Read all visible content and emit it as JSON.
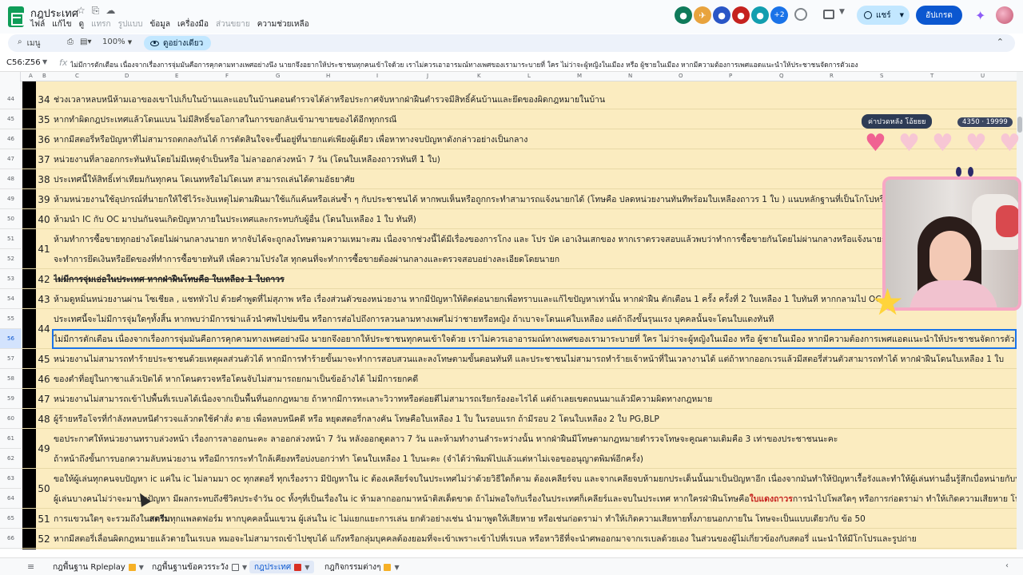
{
  "header": {
    "doc_title": "กฎประเทศ",
    "menu": [
      "ไฟล์",
      "แก้ไข",
      "ดู",
      "แทรก",
      "รูปแบบ",
      "ข้อมูล",
      "เครื่องมือ",
      "ส่วนขยาย",
      "ความช่วยเหลือ"
    ],
    "collab_more": "+2",
    "share_label": "แชร์",
    "update_label": "อัปเกรด"
  },
  "toolbar": {
    "search_label": "เมนู",
    "zoom": "100%",
    "view_mode": "ดูอย่างเดียว"
  },
  "formula_bar": {
    "name_box": "C56:Z56",
    "formula": "ไม่มีการตักเตือน เนื่องจากเรื่องการจุ่มมันคือการคุกคามทางเพศอย่างนึง นายกจึงอยากให้ประชาชนทุกคนเข้าใจด้วย เราไม่ควรเอาอารมณ์ทางเพศของเรามาระบายที่ ใคร ไม่ว่าจะผู้หญิงในเมือง หรือ ผู้ชายในเมือง หากมีความต้องการเพศแอดแนะนำให้ประชาชนจัดการตัวเอง"
  },
  "columns": [
    "A",
    "B",
    "C",
    "D",
    "E",
    "F",
    "G",
    "H",
    "I",
    "J",
    "K",
    "L",
    "M",
    "N",
    "O",
    "P",
    "Q",
    "R",
    "S",
    "T",
    "U"
  ],
  "rows": [
    {
      "row": "44",
      "num": "34",
      "text": "ช่วงเวลาหลบหนีห้ามเอาของเขาไปเก็บในบ้านและแอบในบ้านตอนตำรวจได้ล่าหรือประกาศจับหากฝ่าฝืนตำรวจมีสิทธิ์ค้นบ้านและยึดของผิดกฎหมายในบ้าน"
    },
    {
      "row": "45",
      "num": "35",
      "text": "หากทำผิดกฎประเทศแล้วโดนแบน ไม่มีสิทธิ์ขอโอกาสในการขอกลับเข้ามาขายของได้อีกทุกกรณี"
    },
    {
      "row": "46",
      "num": "36",
      "text": "หากมีสตอรี่หรือปัญหาที่ไม่สามารถตกลงกันได้ การตัดสินใจจะขึ้นอยู่ที่นายกแต่เพียงผู้เดียว เพื่อหาทางจบปัญหาดังกล่าวอย่างเป็นกลาง"
    },
    {
      "row": "47",
      "num": "37",
      "text": "หน่วยงานที่ลาออกกระทันหันโดยไม่มีเหตุจำเป็นหรือ ไม่ลาออกล่วงหน้า 7 วัน (โดนใบเหลืองถาวรทันที 1 ใบ)"
    },
    {
      "row": "48",
      "num": "38",
      "text": "ประเทศนี้ให้สิทธิ์เท่าเทียมกันทุกคน โดเนทหรือไม่โดเนท สามารถเล่นได้ตามอัธยาศัย"
    },
    {
      "row": "49",
      "num": "39",
      "text": "ห้ามหน่วยงานใช้อุปกรณ์ที่นายกให้ใช้ไว้ระงับเหตุไม่ตามฝืนมาใช้แก้แค้นหรือเล่นซ้ำ ๆ กับประชาชนได้ หากพบเห็นหรือถูกกระทำสามารถแจ้งนายกได้ (โทษคือ ปลดหน่วยงานทันทีพร้อมใบเหลืองถาวร 1 ใบ ) แนบหลักฐานที่เป็นโกโปหรือภาพ"
    },
    {
      "row": "50",
      "num": "40",
      "text": "ห้ามนำ IC กับ OC  มาปนกันจนเกิดปัญหาภายในประเทศและกระทบกับผู้อื่น (โดนใบเหลือง 1 ใบ ทันที)"
    },
    {
      "row": "51",
      "num": "",
      "text": "ห้ามทำการซื้อขายทุกอย่างโดยไม่ผ่านกลางนายก หากจับได้จะถูกลงโทษตามความเหมาะสม เนื่องจากช่วงนี้ได้มีเรื่องของการโกง และ โปร บัค เอาเงินเสกของ หากเราตรวจสอบแล้วพบว่าทำการซื้อขายกันโดยไม่ผ่านกลางหรือแจ้งนายก"
    },
    {
      "row": "52",
      "num": "41",
      "text": "จะทำการยึดเงินหรือยึดของที่ทำการซื้อขายทันที เพื่อความโปร่งใส ทุกคนที่จะทำการซื้อขายต้องผ่านกลางและตรวจสอบอย่างละเอียดโดยนายก"
    },
    {
      "row": "53",
      "num": "42",
      "text": "ไม่มีการจุ่มเอ่อในประเทศ หากฝ่าฝืนโทษคือ ใบเหลือง 1 ใบถาวร"
    },
    {
      "row": "54",
      "num": "43",
      "text": "ห้ามดูหมิ่นหน่วยงานผ่าน โซเชียล , แชทหัวไป ด้วยคำพูดที่ไม่สุภาพ หรือ เรื่องส่วนตัวของหน่วยงาน หากมีปัญหาให้ติดต่อนายกเพื่อทราบและแก้ไขปัญหาเท่านั้น หากฝ่าฝืน ตักเตือน 1 ครั้ง ครั้งที่ 2 ใบเหลือง 1 ใบทันที หากกลามไป OC จะถูก"
    },
    {
      "row": "55",
      "num": "",
      "text": "ประเทศนี้จะไม่มีการจุ่มใดๆทั้งสิ้น หากพบว่ามีการฆ่าแล้วนำศพไปข่มขืน หรือการส่อไปถึงการลวนลามทางเพศไม่ว่าชายหรือหญิง ถ้าเบาจะโดนแค่ใบเหลือง แต่ถ้าถึงขั้นรุนแรง บุคคลนั้นจะโดนใบแดงทันที"
    },
    {
      "row": "56",
      "num": "44",
      "text": "ไม่มีการตักเตือน เนื่องจากเรื่องการจุ่มมันคือการคุกคามทางเพศอย่างนึง นายกจึงอยากให้ประชาชนทุกคนเข้าใจด้วย เราไม่ควรเอาอารมณ์ทางเพศของเรามาระบายที่ ใคร ไม่ว่าจะผู้หญิงในเมือง หรือ ผู้ชายในเมือง หากมีความต้องการเพศแอดแนะนำให้ประชาชนจัดการตัวเอง"
    },
    {
      "row": "57",
      "num": "45",
      "text": "หน่วยงานไม่สามารถทำร้ายประชาชนด้วยเหตุผลส่วนตัวได้ หากมีการทำร้ายขั้นมาจะทำการสอบสวนและลงโทษตามขั้นตอนทันที และประชาชนไม่สามารถทำร้ายเจ้าหน้าที่ในเวลางานได้ แต่ถ้าหากออกเวรแล้วมีสตอรี่ส่วนตัวสามารถทำได้ หากฝ่าฝืนโดนใบเหลือง 1 ใบ"
    },
    {
      "row": "58",
      "num": "46",
      "text": "ของตำที่อยู่ในกาซาแล้วเปิดได้ หากโดนตรวจหรือโดนจับไม่สามารถยกมาเป็นข้ออ้างได้ ไม่มีการยกคดี"
    },
    {
      "row": "59",
      "num": "47",
      "text": "หน่วยงานไม่สามารถเข้าไปพื้นที่เรเบลได้เนื่องจากเป็นพื้นที่นอกกฎหมาย ถ้าหากมีการทะเลาะวิวาทหรือต่อยตีไม่สามารถเรียกร้องอะไรได้  แต่ถ้าเลยเขตถนนมาแล้วมีความผิดทางกฎหมาย"
    },
    {
      "row": "60",
      "num": "48",
      "text": "ผู้ร้ายหรือโจรที่กำลังหลบหนีตำรวจแล้วกดใช้คำสั่ง ตาย เพื่อหลบหนีคดี หรือ หยุดสตอรี่กลางคัน โทษคือใบเหลือง 1 ใบ ในรอบแรก ถ้ามีรอบ 2 โดนใบเหลือง 2 ใบ PG,BLP"
    },
    {
      "row": "61",
      "num": "",
      "text": "ขอประกาศให้หน่วยงานทราบล่วงหน้า เรื่องการลาออกนะคะ ลาออกล่วงหน้า 7 วัน หลังออกดูตลาว 7 วัน และห้ามทำงานลำระหว่างนั้น หากฝ่าฝืนมีโทษตามกฎหมายตำรวจโทษจะคูณตามเดิมคือ 3 เท่าของประชาชนนะคะ"
    },
    {
      "row": "62",
      "num": "49",
      "text": "ถ้าหน้าถึงขั้นการบอกความลับหน่วยงาน หรือมีการกระทำใกล้เคียงหรือบ่งบอกว่าทำ โดนใบเหลือง 1 ใบนะคะ (จำได้ว่าพิมพ์ไปแล้วแต่หาไม่เจอขออนุญาตพิมพ์อีกครั้ง)"
    },
    {
      "row": "63",
      "num": "",
      "text": "ขอให้ผู้เล่นทุกคนจบปัญหา ic แค่ใน ic ไม่ลามมา oc ทุกสตอรี่ ทุกเรื่องราว มีปัญหาใน ic ต้องเคลียร์จบในประเทศไม่ว่าด้วยวิธีใดก็ตาม ต้องเคลียร์จบ และจากเคลียจบห้ามยกประเด็นนั้นมาเป็นปัญหาอีก เนื่องจากมันทำให้ปัญหาเรื้อรังและทำให้ผู้เล่นท่านอื่นรู้สึกเบื่อหน่ายกับปัญ"
    },
    {
      "row": "64",
      "num": "50",
      "text": "ผู้เล่นบางคนไม่ว่าจะมาปนปัญหา มีผลกระทบถึงชีวิตประจำวัน oc ทั้งๆที่เป็นเรื่องใน ic  ห้ามลากออกมาหน้าติสเด็ดขาด ถ้าไม่พอใจกับเรื่องในประเทศก็เคลียร์และจบในประเทศ หากใครฝ่าฝืนโทษคือ",
      "red": "ใบแดงถาวร",
      "tail": " การนำไปโพสใดๆ หรือการก่อดราม่า ทำให้เกิดความเสียหาย โทษ เริ่ม"
    },
    {
      "row": "65",
      "num": "51",
      "text_a": "การแขวนใดๆ จะรวมถึงใน",
      "bold": "สตรีม",
      "text": "ทุกแพลตฟอร์ม หากบุคคลนั้นแขวน ผู้เล่นใน ic ไม่แยกแยะการเล่น ยกตัวอย่างเช่น นำมาพูดให้เสียหาย หรือเช่นก่อดราม่า ทำให้เกิดความเสียหายทั้งภายนอกภายใน โทษจะเป็นแบบเดียวกับ ข้อ 50"
    },
    {
      "row": "66",
      "num": "52",
      "text": "หากมีสตอรี่เลื่อนผิดกฎหมายแล้วตายในเรเบล หมอจะไม่สามารถเข้าไปชุบได้ แก๊งหรือกลุ่มบุคคลต้องยอมที่จะเข้าเพราะเข้าไปที่เรเบล หรือหาวิธีที่จะนำศพออกมาจากเรเบลด้วยเอง ในส่วนของผู้ไม่เกี่ยวข้องกับสตอรี่ แนะนำให้มีโกโปรและรูปถ่าย"
    }
  ],
  "overlay": {
    "label": "ค่าปวดหลัง โอ้ยยย",
    "count": "4350 · 19999",
    "hearts_filled": 1,
    "hearts_total": 5
  },
  "tabs": [
    {
      "label": "กฎพื้นฐาน Rpleplay",
      "color": "#f6b026",
      "active": false
    },
    {
      "label": "กฎพื้นฐานข้อควรระวัง",
      "color": "#ffffff",
      "active": false
    },
    {
      "label": "กฎประเทศ",
      "color": "#d93025",
      "active": true
    },
    {
      "label": "กฎกิจกรรมต่างๆ",
      "color": "#f6b026",
      "active": false
    }
  ]
}
